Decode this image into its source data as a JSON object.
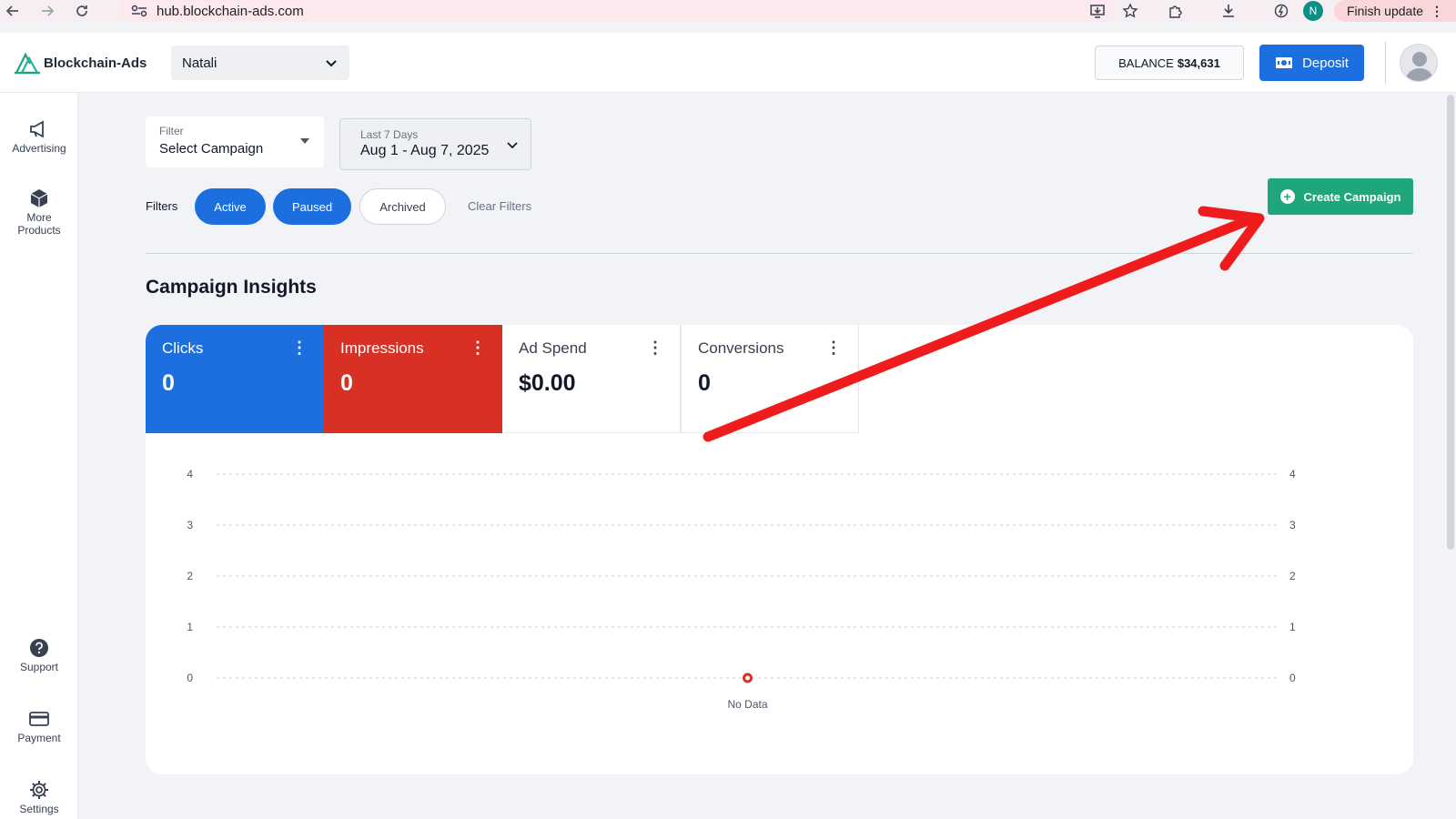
{
  "browser": {
    "url": "hub.blockchain-ads.com",
    "profile_initial": "N",
    "finish_update_label": "Finish update"
  },
  "header": {
    "brand": "Blockchain-Ads",
    "account_name": "Natali",
    "balance_label": "BALANCE",
    "balance_amount": "$34,631",
    "deposit_label": "Deposit"
  },
  "sidebar": {
    "items": [
      {
        "label": "Advertising",
        "icon": "megaphone-icon"
      },
      {
        "label": "More Products",
        "icon": "cube-icon"
      },
      {
        "label": "Support",
        "icon": "help-icon"
      },
      {
        "label": "Payment",
        "icon": "credit-card-icon"
      },
      {
        "label": "Settings",
        "icon": "gear-icon"
      }
    ]
  },
  "filters": {
    "campaign_select_label": "Filter",
    "campaign_select_value": "Select Campaign",
    "date_range_label": "Last 7 Days",
    "date_range_value": "Aug 1 - Aug 7, 2025",
    "filters_label": "Filters",
    "chips": [
      {
        "label": "Active",
        "selected": true
      },
      {
        "label": "Paused",
        "selected": true
      },
      {
        "label": "Archived",
        "selected": false
      }
    ],
    "clear_label": "Clear Filters"
  },
  "create_campaign_label": "Create Campaign",
  "insights": {
    "title": "Campaign Insights",
    "metrics": [
      {
        "label": "Clicks",
        "value": "0",
        "color": "#1d6fe0"
      },
      {
        "label": "Impressions",
        "value": "0",
        "color": "#d93025"
      },
      {
        "label": "Ad Spend",
        "value": "$0.00",
        "color": "#ffffff"
      },
      {
        "label": "Conversions",
        "value": "0",
        "color": "#ffffff"
      }
    ]
  },
  "chart_data": {
    "type": "line",
    "y_ticks": [
      0,
      1,
      2,
      3,
      4
    ],
    "ylim": [
      0,
      4
    ],
    "grid": true,
    "x_labels": [
      "No Data"
    ],
    "series": [
      {
        "values": [
          0
        ],
        "color": "#d93025"
      }
    ]
  },
  "colors": {
    "accent": "#1d6fe0",
    "create": "#1fa67a",
    "annotation_arrow": "#ee1c1c"
  }
}
